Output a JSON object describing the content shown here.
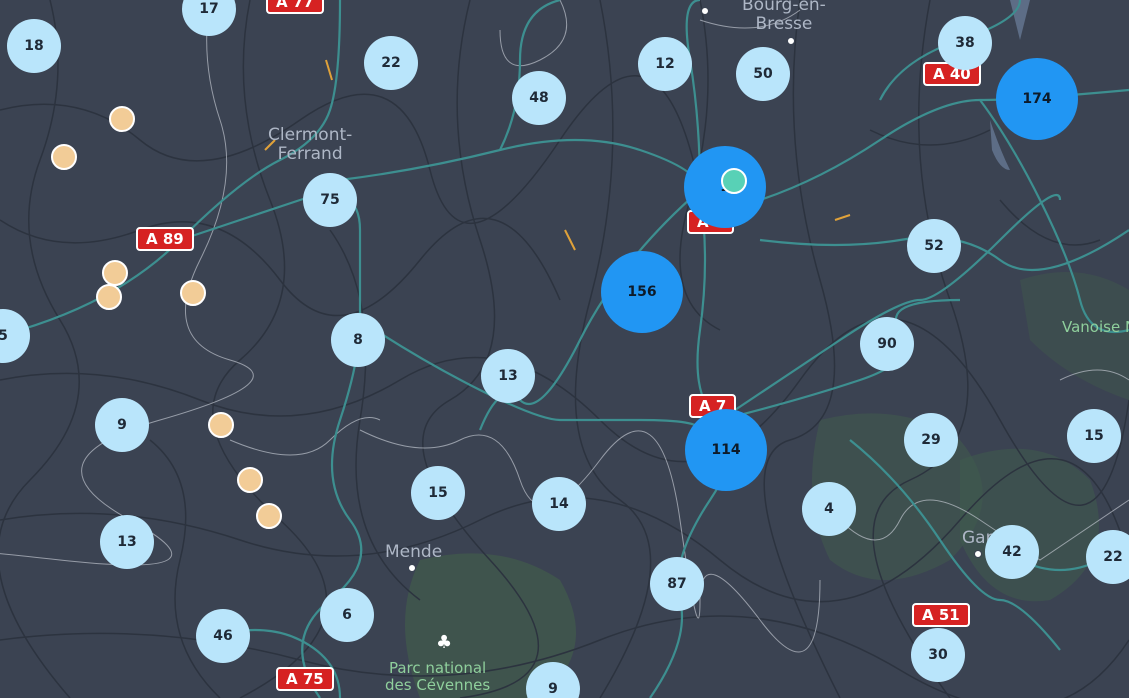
{
  "places": {
    "clermont": "Clermont-\nFerrand",
    "bourg": "Bourg-en-\nBresse",
    "mende": "Mende",
    "gap": "Gap",
    "vanoise": "Vanoise N",
    "park": "Parc national\ndes Cévennes"
  },
  "roads": {
    "a77": "A 77",
    "a89": "A 89",
    "a40": "A 40",
    "a6": "A 6",
    "a7": "A 7",
    "a51": "A 51",
    "a75": "A 75"
  },
  "clusters": [
    {
      "id": "c17",
      "label": "17"
    },
    {
      "id": "c18",
      "label": "18"
    },
    {
      "id": "c22a",
      "label": "22"
    },
    {
      "id": "c48",
      "label": "48"
    },
    {
      "id": "c12",
      "label": "12"
    },
    {
      "id": "c50",
      "label": "50"
    },
    {
      "id": "c38",
      "label": "38"
    },
    {
      "id": "c174",
      "label": "174"
    },
    {
      "id": "c75",
      "label": "75"
    },
    {
      "id": "c1",
      "label": "1"
    },
    {
      "id": "c52",
      "label": "52"
    },
    {
      "id": "c156",
      "label": "156"
    },
    {
      "id": "c5",
      "label": "5"
    },
    {
      "id": "c8",
      "label": "8"
    },
    {
      "id": "c13a",
      "label": "13"
    },
    {
      "id": "c90",
      "label": "90"
    },
    {
      "id": "c9a",
      "label": "9"
    },
    {
      "id": "c114",
      "label": "114"
    },
    {
      "id": "c29",
      "label": "29"
    },
    {
      "id": "c15a",
      "label": "15"
    },
    {
      "id": "c15b",
      "label": "15"
    },
    {
      "id": "c14",
      "label": "14"
    },
    {
      "id": "c4",
      "label": "4"
    },
    {
      "id": "c13b",
      "label": "13"
    },
    {
      "id": "c42",
      "label": "42"
    },
    {
      "id": "c22b",
      "label": "22"
    },
    {
      "id": "c87",
      "label": "87"
    },
    {
      "id": "c6",
      "label": "6"
    },
    {
      "id": "c46",
      "label": "46"
    },
    {
      "id": "c30",
      "label": "30"
    },
    {
      "id": "c9b",
      "label": "9"
    }
  ],
  "colors": {
    "background": "#3b4352",
    "cluster_small": "#b9e5fb",
    "cluster_large": "#2196f3",
    "poi": "#f2cc97",
    "current": "#58d1b6",
    "shield": "#d62222",
    "highway": "#3d8f90"
  },
  "icons": {
    "park": "park-tree-icon"
  }
}
